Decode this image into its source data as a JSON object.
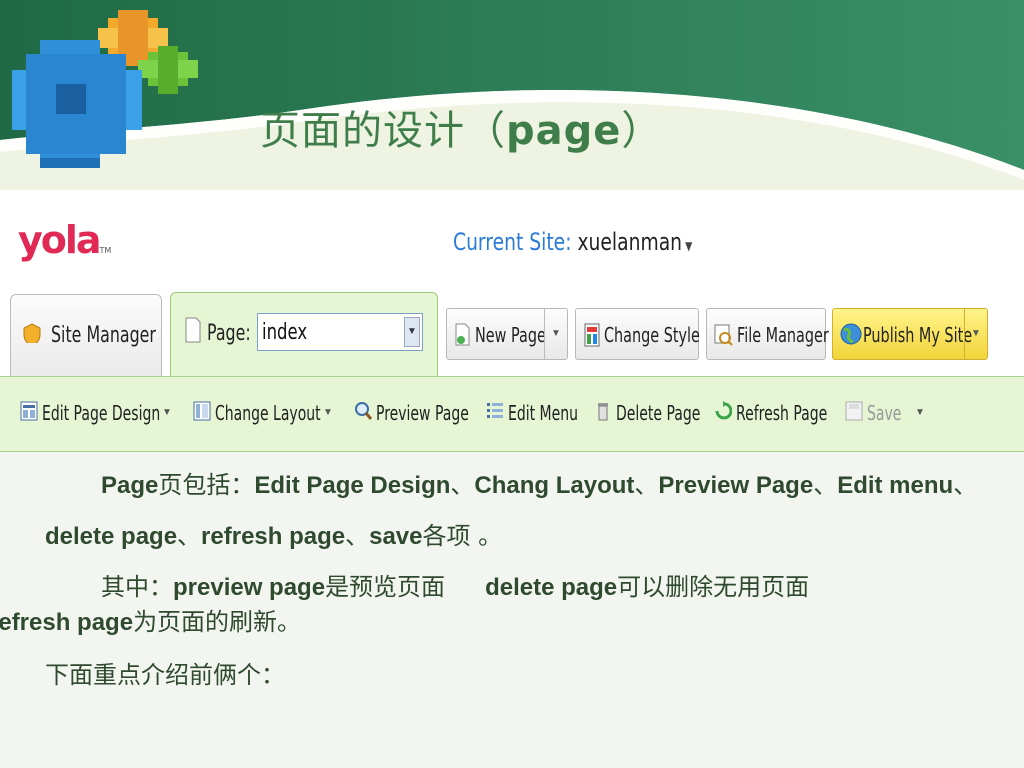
{
  "slide": {
    "title_cn": "页面的设计（",
    "title_en": "page",
    "title_close": "）"
  },
  "app": {
    "logo": "yola",
    "logo_tm": "TM",
    "current_site_label": "Current Site:",
    "current_site_value": "xuelanman",
    "tabs": {
      "site_manager": "Site Manager",
      "page_label": "Page:",
      "page_value": "index"
    },
    "buttons": {
      "new_page": "New Page",
      "change_style": "Change Style",
      "file_manager": "File Manager",
      "publish": "Publish My Site"
    },
    "toolbar": {
      "edit_page_design": "Edit Page Design",
      "change_layout": "Change Layout",
      "preview_page": "Preview Page",
      "edit_menu": "Edit Menu",
      "delete_page": "Delete Page",
      "refresh_page": "Refresh Page",
      "save": "Save"
    }
  },
  "text": {
    "p1_a": "Page",
    "p1_b": "页包括：",
    "p1_c": "Edit Page Design",
    "p1_d": "、",
    "p1_e": "Chang Layout",
    "p1_f": "、",
    "p1_g": "Preview Page",
    "p1_h": "、",
    "p1_i": "Edit menu",
    "p1_j": "、",
    "p2_a": "delete page",
    "p2_b": "、",
    "p2_c": "refresh page",
    "p2_d": "、",
    "p2_e": "save",
    "p2_f": "各项 。",
    "p3_a": "其中：",
    "p3_b": "preview page",
    "p3_c": "是预览页面",
    "p3_d": "delete page",
    "p3_e": "可以删除无用页面",
    "p3_f": "refresh page",
    "p3_g": "为页面的刷新。",
    "p4": "下面重点介绍前俩个："
  },
  "colors": {
    "header_green": "#2f7a55",
    "title_green": "#3f7e4a",
    "toolbar_bg": "#e6f5d4",
    "logo_pink": "#e02a55",
    "site_blue": "#2a7bd6"
  }
}
